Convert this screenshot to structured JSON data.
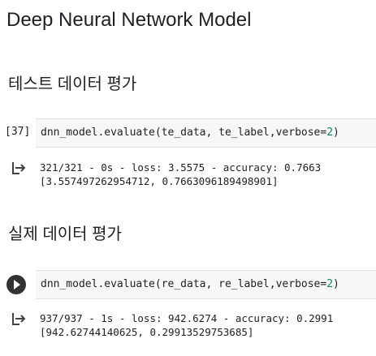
{
  "notebook": {
    "title": "Deep Neural Network Model",
    "sections": [
      {
        "heading": "테스트 데이터 평가",
        "cell": {
          "execution_count": "[37]",
          "code_before": "dnn_model.evaluate(te_data, te_label,verbose=",
          "code_arg": "2",
          "code_after": ")",
          "output_lines": [
            "321/321 - 0s - loss: 3.5575 - accuracy: 0.7663",
            "[3.557497262954712, 0.7663096189498901]"
          ]
        }
      },
      {
        "heading": "실제 데이터 평가",
        "cell": {
          "code_before": "dnn_model.evaluate(re_data, re_label,verbose=",
          "code_arg": "2",
          "code_after": ")",
          "output_lines": [
            "937/937 - 1s - loss: 942.6274 - accuracy: 0.2991",
            "[942.62744140625, 0.29913529753685]"
          ]
        }
      }
    ],
    "colors": {
      "number_literal": "#09885a",
      "cell_background": "#f7f7f7",
      "run_button": "#333333"
    },
    "icons": {
      "run": "play-icon",
      "output": "output-arrow-icon"
    }
  }
}
